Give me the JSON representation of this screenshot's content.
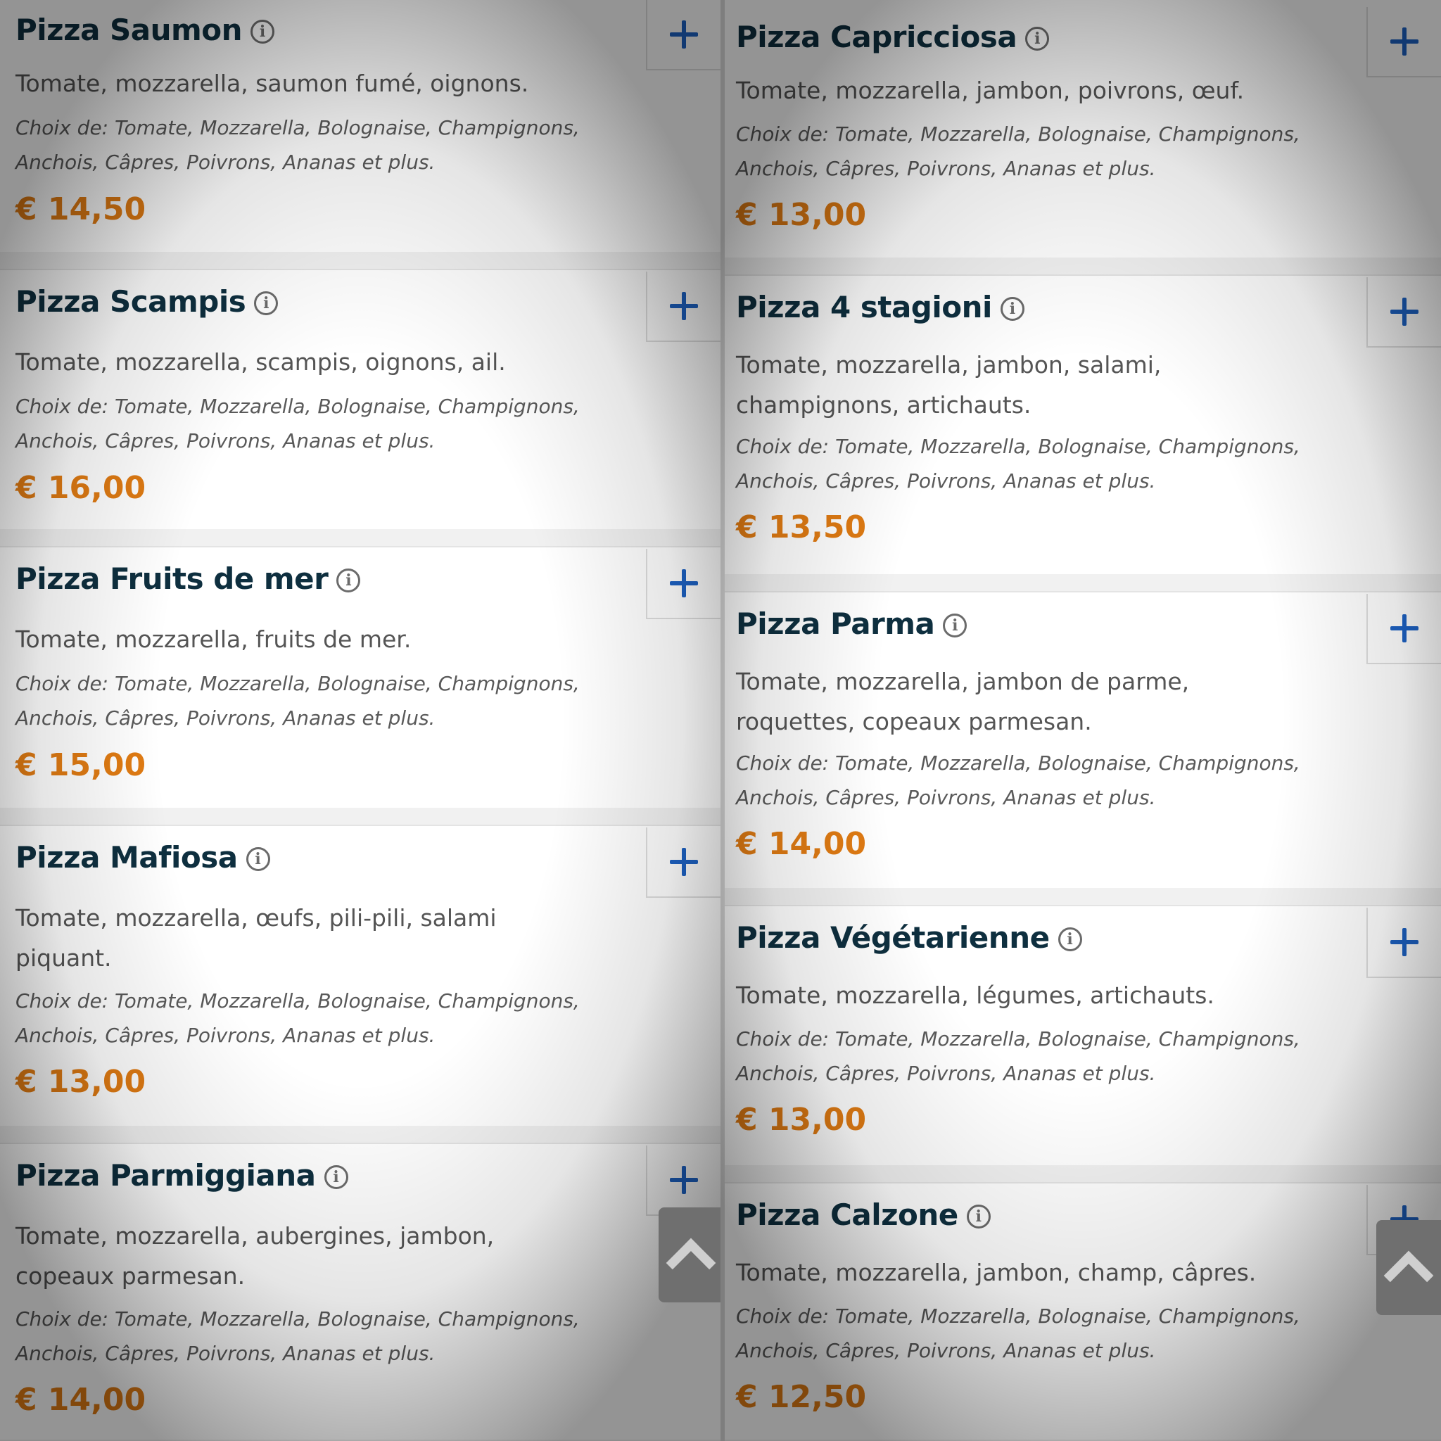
{
  "choice_text": "Choix de: Tomate, Mozzarella, Bolognaise, Champignons, Anchois, Câpres, Poivrons, Ananas et plus.",
  "info_icon": "info-circle-icon",
  "add_icon": "plus-icon",
  "scroll_icon": "chevron-up-icon",
  "colors": {
    "title": "#0e2f3f",
    "price": "#e07b13",
    "add": "#1d62c4",
    "text": "#555555"
  },
  "left_column": [
    {
      "name": "Pizza Saumon",
      "description": "Tomate, mozzarella, saumon fumé, oignons.",
      "price": "€ 14,50"
    },
    {
      "name": "Pizza Scampis",
      "description": "Tomate, mozzarella, scampis, oignons, ail.",
      "price": "€ 16,00"
    },
    {
      "name": "Pizza Fruits de mer",
      "description": "Tomate, mozzarella, fruits de mer.",
      "price": "€ 15,00"
    },
    {
      "name": "Pizza Mafiosa",
      "description": "Tomate, mozzarella, œufs, pili-pili, salami piquant.",
      "price": "€ 13,00"
    },
    {
      "name": "Pizza Parmiggiana",
      "description": "Tomate, mozzarella, aubergines, jambon, copeaux parmesan.",
      "price": "€ 14,00"
    }
  ],
  "right_column": [
    {
      "name": "Pizza Capricciosa",
      "description": "Tomate, mozzarella, jambon, poivrons, œuf.",
      "price": "€ 13,00"
    },
    {
      "name": "Pizza 4 stagioni",
      "description": "Tomate, mozzarella, jambon, salami, champignons, artichauts.",
      "price": "€ 13,50"
    },
    {
      "name": "Pizza Parma",
      "description": "Tomate, mozzarella, jambon de parme, roquettes, copeaux parmesan.",
      "price": "€ 14,00"
    },
    {
      "name": "Pizza Végétarienne",
      "description": "Tomate, mozzarella, légumes, artichauts.",
      "price": "€ 13,00"
    },
    {
      "name": "Pizza Calzone",
      "description": "Tomate, mozzarella, jambon, champ, câpres.",
      "price": "€ 12,50"
    }
  ]
}
